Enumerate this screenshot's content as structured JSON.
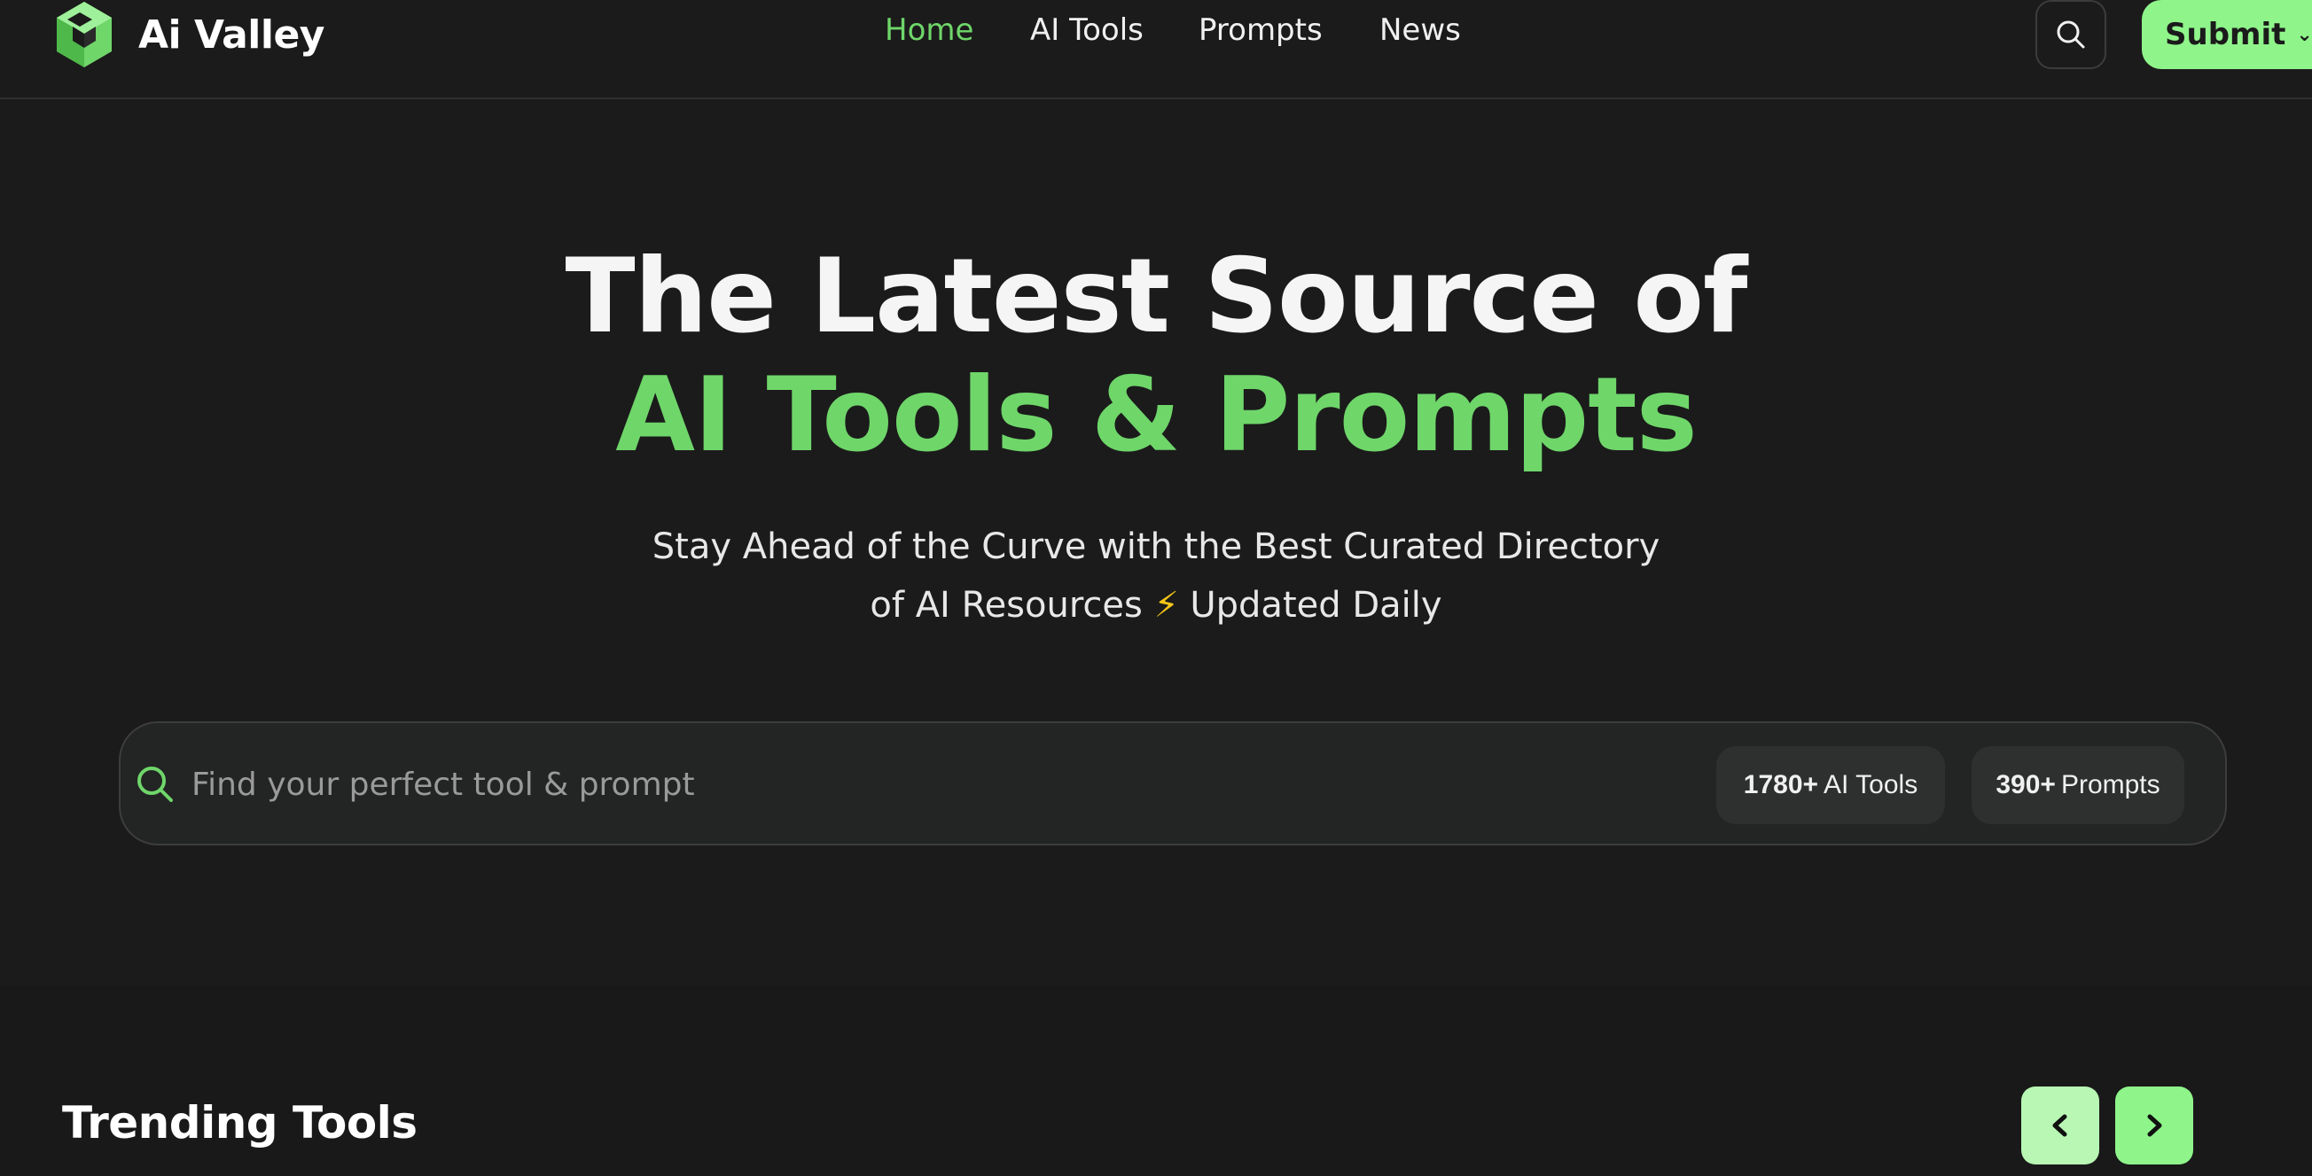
{
  "brand": {
    "name": "Ai Valley",
    "accent": "#6fd66a",
    "button_bg": "#8ff58a"
  },
  "nav": {
    "items": [
      {
        "label": "Home",
        "active": true
      },
      {
        "label": "AI Tools",
        "active": false
      },
      {
        "label": "Prompts",
        "active": false
      },
      {
        "label": "News",
        "active": false
      }
    ],
    "search_icon": "search-icon",
    "submit_label": "Submit"
  },
  "hero": {
    "title_line1": "The Latest Source of",
    "title_line2": "AI Tools & Prompts",
    "subtitle_line1": "Stay Ahead of the Curve with the Best Curated Directory",
    "subtitle_line2_a": "of AI Resources",
    "subtitle_bolt": "⚡",
    "subtitle_line2_b": "Updated Daily"
  },
  "search": {
    "placeholder": "Find your perfect tool & prompt",
    "value": "",
    "stats": [
      {
        "count": "1780+",
        "label": "AI Tools"
      },
      {
        "count": "390+",
        "label": "Prompts"
      }
    ]
  },
  "trending": {
    "title": "Trending Tools",
    "prev_icon": "chevron-left-icon",
    "next_icon": "chevron-right-icon"
  }
}
